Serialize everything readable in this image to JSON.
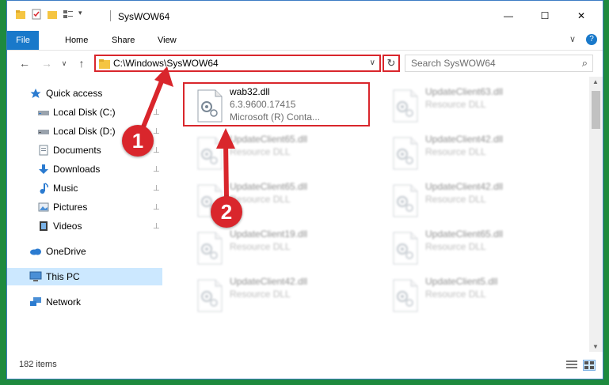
{
  "window": {
    "title": "SysWOW64",
    "minimize_glyph": "—",
    "maximize_glyph": "☐",
    "close_glyph": "✕"
  },
  "ribbon": {
    "tabs": [
      "File",
      "Home",
      "Share",
      "View"
    ],
    "help_glyph": "?"
  },
  "nav": {
    "back_glyph": "←",
    "forward_glyph": "→",
    "history_glyph": "∨",
    "up_glyph": "↑",
    "address": "C:\\Windows\\SysWOW64",
    "address_dropdown_glyph": "∨",
    "refresh_glyph": "↻",
    "search_placeholder": "Search SysWOW64",
    "search_glyph": "⌕"
  },
  "sidebar": {
    "items": [
      {
        "label": "Quick access",
        "icon": "star-icon",
        "pinned": false
      },
      {
        "label": "Local Disk (C:)",
        "icon": "drive-icon",
        "pinned": true
      },
      {
        "label": "Local Disk (D:)",
        "icon": "drive-icon",
        "pinned": true
      },
      {
        "label": "Documents",
        "icon": "documents-icon",
        "pinned": true
      },
      {
        "label": "Downloads",
        "icon": "download-icon",
        "pinned": true
      },
      {
        "label": "Music",
        "icon": "music-icon",
        "pinned": true
      },
      {
        "label": "Pictures",
        "icon": "pictures-icon",
        "pinned": true
      },
      {
        "label": "Videos",
        "icon": "videos-icon",
        "pinned": true
      },
      {
        "label": "OneDrive",
        "icon": "cloud-icon",
        "pinned": false
      },
      {
        "label": "This PC",
        "icon": "computer-icon",
        "pinned": false,
        "selected": true
      },
      {
        "label": "Network",
        "icon": "network-icon",
        "pinned": false
      }
    ],
    "pin_glyph": "📌"
  },
  "files": [
    {
      "name": "wab32.dll",
      "line1": "6.3.9600.17415",
      "line2": "Microsoft (R) Conta...",
      "highlighted": true
    },
    {
      "name": "UpdateClient63.dll",
      "line1": "Resource DLL",
      "line2": ""
    },
    {
      "name": "UpdateClient65.dll",
      "line1": "Resource DLL",
      "line2": ""
    },
    {
      "name": "UpdateClient42.dll",
      "line1": "Resource DLL",
      "line2": ""
    },
    {
      "name": "UpdateClient65.dll",
      "line1": "Resource DLL",
      "line2": ""
    },
    {
      "name": "UpdateClient42.dll",
      "line1": "Resource DLL",
      "line2": ""
    },
    {
      "name": "UpdateClient19.dll",
      "line1": "Resource DLL",
      "line2": ""
    },
    {
      "name": "UpdateClient65.dll",
      "line1": "Resource DLL",
      "line2": ""
    },
    {
      "name": "UpdateClient42.dll",
      "line1": "Resource DLL",
      "line2": ""
    },
    {
      "name": "UpdateClient5.dll",
      "line1": "Resource DLL",
      "line2": ""
    }
  ],
  "status": {
    "item_count": "182 items"
  },
  "annotations": {
    "step1": "1",
    "step2": "2",
    "color": "#d9262c"
  }
}
